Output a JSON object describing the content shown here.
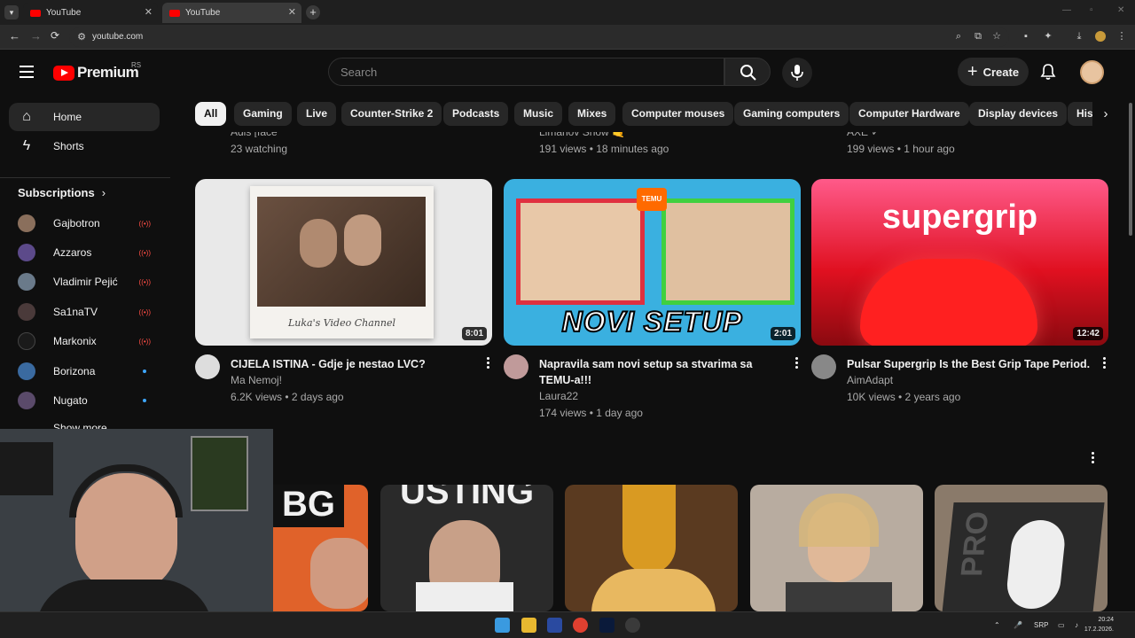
{
  "browser": {
    "tabs": [
      {
        "title": "YouTube",
        "active": false
      },
      {
        "title": "YouTube",
        "active": true
      }
    ],
    "url": "youtube.com"
  },
  "header": {
    "logo_text": "Premium",
    "region": "RS",
    "search_placeholder": "Search",
    "create_label": "Create"
  },
  "sidebar": {
    "nav": [
      {
        "label": "Home",
        "icon": "home-icon",
        "active": true
      },
      {
        "label": "Shorts",
        "icon": "shorts-icon",
        "active": false
      }
    ],
    "subscriptions_label": "Subscriptions",
    "subscriptions": [
      {
        "name": "Gajbotron",
        "status": "live",
        "color": "#8a6f5c"
      },
      {
        "name": "Azzaros",
        "status": "live",
        "color": "#5c4a8a"
      },
      {
        "name": "Vladimir Pejić",
        "status": "live",
        "color": "#6a7a8a"
      },
      {
        "name": "Sa1naTV",
        "status": "live",
        "color": "#4a3a3a"
      },
      {
        "name": "Markonix",
        "status": "live",
        "color": "#1a1a1a"
      },
      {
        "name": "Borizona",
        "status": "new",
        "color": "#3a6aa0"
      },
      {
        "name": "Nugato",
        "status": "new",
        "color": "#5a4a6a"
      }
    ],
    "show_more": "Show more"
  },
  "chips": [
    "All",
    "Gaming",
    "Live",
    "Counter-Strike 2",
    "Podcasts",
    "Music",
    "Mixes",
    "Computer mouses",
    "Gaming computers",
    "Computer Hardware",
    "Display devices",
    "Hist"
  ],
  "previous_row": [
    {
      "channel": "Adis [face",
      "meta": "23 watching"
    },
    {
      "channel": "Limanov Show 🤙",
      "meta": "191 views • 18 minutes ago"
    },
    {
      "channel": "AXE ✓",
      "meta": "199 views • 1 hour ago"
    }
  ],
  "videos": [
    {
      "title": "CIJELA ISTINA - Gdje je nestao LVC?",
      "channel": "Ma Nemoj!",
      "meta": "6.2K views • 2 days ago",
      "duration": "8:01",
      "thumb_caption": "Luka's Video Channel"
    },
    {
      "title": "Napravila sam novi setup sa stvarima sa TEMU-a!!!",
      "channel": "Laura22",
      "meta": "174 views • 1 day ago",
      "duration": "2:01",
      "thumb_caption": "NOVI SETUP",
      "thumb_badge": "TEMU"
    },
    {
      "title": "Pulsar Supergrip Is the Best Grip Tape Period.",
      "channel": "AimAdapt",
      "meta": "10K views • 2 years ago",
      "duration": "12:42",
      "thumb_caption": "supergrip"
    }
  ],
  "shelf": [
    {
      "caption": "BG",
      "color": "#e0622a"
    },
    {
      "caption": "USTING",
      "color": "#2a2a2a"
    },
    {
      "caption": "",
      "color": "#d99a22"
    },
    {
      "caption": "",
      "color": "#9a8a7a"
    },
    {
      "caption": "PRO",
      "color": "#6a6a6a"
    }
  ],
  "taskbar": {
    "lang": "SRP",
    "time": "20:24",
    "date": "17.2.2026."
  }
}
